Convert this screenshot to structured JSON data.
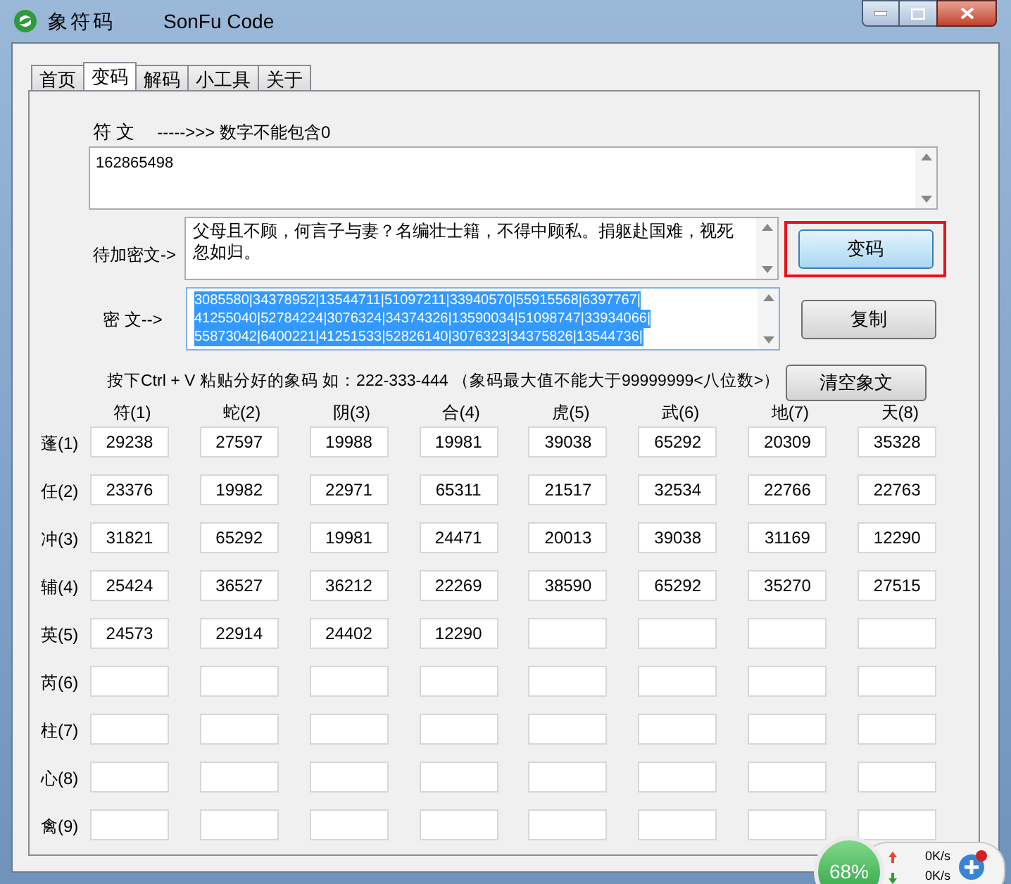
{
  "window": {
    "title": "象符码",
    "subtitle": "SonFu Code"
  },
  "tabs": [
    {
      "label": "首页",
      "selected": false
    },
    {
      "label": "变码",
      "selected": true
    },
    {
      "label": "解码",
      "selected": false
    },
    {
      "label": "小工具",
      "selected": false
    },
    {
      "label": "关于",
      "selected": false
    }
  ],
  "source": {
    "label": "符 文",
    "hint": "----->>> 数字不能包含0",
    "value": "162865498"
  },
  "plaintext": {
    "label": "待加密文->",
    "value": "父母且不顾，何言子与妻？名编壮士籍，不得中顾私。捐躯赴国难，视死忽如归。"
  },
  "encode_button": {
    "label": "变码",
    "highlighted": true
  },
  "ciphertext": {
    "label": "密 文-->",
    "selected": true,
    "lines": [
      "3085580|34378952|13544711|51097211|33940570|55915568|6397767|",
      "41255040|52784224|3076324|34374326|13590034|51098747|33934066|",
      "55873042|6400221|41251533|52826140|3076323|34375826|13544736|"
    ]
  },
  "copy_button": {
    "label": "复制"
  },
  "instruction": "按下Ctrl + V 粘贴分好的象码 如：222-333-444 （象码最大值不能大于99999999<八位数>）",
  "clear_button": {
    "label": "清空象文"
  },
  "grid": {
    "columns": [
      "符(1)",
      "蛇(2)",
      "阴(3)",
      "合(4)",
      "虎(5)",
      "武(6)",
      "地(7)",
      "天(8)"
    ],
    "rows": [
      {
        "label": "蓬(1)",
        "values": [
          "29238",
          "27597",
          "19988",
          "19981",
          "39038",
          "65292",
          "20309",
          "35328"
        ]
      },
      {
        "label": "任(2)",
        "values": [
          "23376",
          "19982",
          "22971",
          "65311",
          "21517",
          "32534",
          "22766",
          "22763"
        ]
      },
      {
        "label": "冲(3)",
        "values": [
          "31821",
          "65292",
          "19981",
          "24471",
          "20013",
          "39038",
          "31169",
          "12290"
        ]
      },
      {
        "label": "辅(4)",
        "values": [
          "25424",
          "36527",
          "36212",
          "22269",
          "38590",
          "65292",
          "35270",
          "27515"
        ]
      },
      {
        "label": "英(5)",
        "values": [
          "24573",
          "22914",
          "24402",
          "12290"
        ]
      },
      {
        "label": "芮(6)",
        "values": []
      },
      {
        "label": "柱(7)",
        "values": []
      },
      {
        "label": "心(8)",
        "values": []
      },
      {
        "label": "禽(9)",
        "values": []
      }
    ]
  },
  "speed_widget": {
    "percent": "68%",
    "upload": "0K/s",
    "download": "0K/s"
  }
}
